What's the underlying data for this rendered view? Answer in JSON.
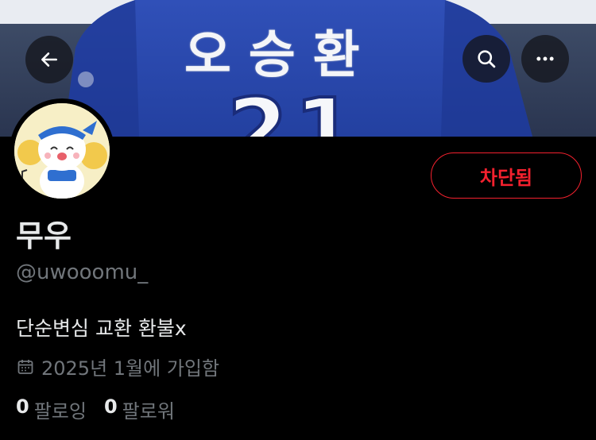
{
  "banner": {
    "jersey_name": "오승환",
    "jersey_number": "21"
  },
  "header": {
    "back_icon": "arrow-left-icon",
    "search_icon": "search-icon",
    "more_icon": "more-horizontal-icon"
  },
  "profile": {
    "blocked_label": "차단됨",
    "display_name": "무우",
    "handle": "@uwooomu_",
    "bio": "단순변심 교환 환불x",
    "joined": "2025년 1월에 가입함",
    "following_count": "0",
    "following_label": "팔로잉",
    "followers_count": "0",
    "followers_label": "팔로워"
  },
  "colors": {
    "accent_red": "#f4212e",
    "muted_text": "#71767b",
    "primary_text": "#e7e9ea",
    "background": "#000000"
  }
}
